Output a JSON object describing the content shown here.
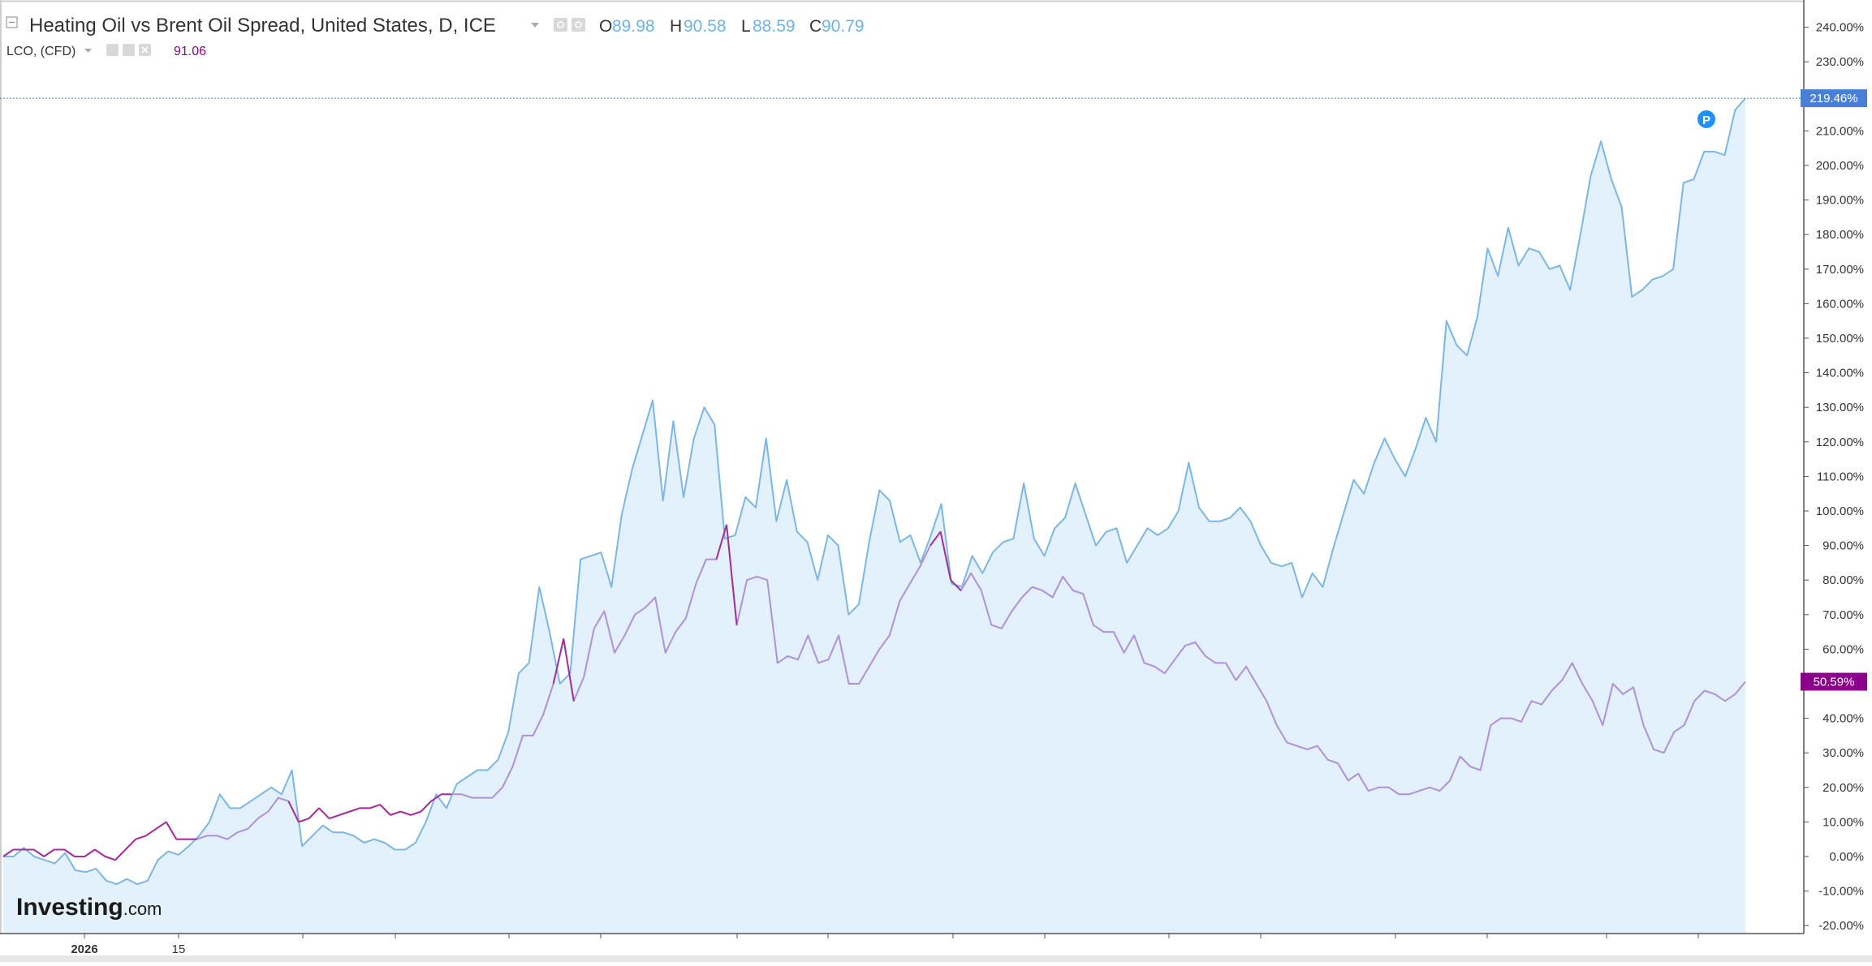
{
  "header": {
    "title": "Heating Oil vs Brent Oil Spread, United States, D, ICE",
    "ohlc": {
      "o_label": "O",
      "o_value": "89.98",
      "h_label": "H",
      "h_value": "90.58",
      "l_label": "L",
      "l_value": "88.59",
      "c_label": "C",
      "c_value": "90.79"
    },
    "compare_label": "LCO, (CFD)",
    "compare_value": "91.06"
  },
  "logo": {
    "brand": "Investing",
    "suffix": ".com"
  },
  "price_tags": {
    "main": "219.46%",
    "compare": "50.59%",
    "marker": "P"
  },
  "colors": {
    "main_line": "#7cb6e4",
    "main_fill": "#e2f1fb",
    "compare_line": "#b090d8",
    "compare_dark": "#a5309a",
    "compare_tag": "#8b008b",
    "main_tag": "#4a7fd8",
    "ohlc_value": "#6fb3e6",
    "grid": "#d8d8d8"
  },
  "chart_data": {
    "type": "line",
    "xlabel": "",
    "ylabel": "",
    "ylim": [
      -22,
      244
    ],
    "y_ticks": [
      "240.00%",
      "230.00%",
      "220.00%",
      "210.00%",
      "200.00%",
      "190.00%",
      "180.00%",
      "170.00%",
      "160.00%",
      "150.00%",
      "140.00%",
      "130.00%",
      "120.00%",
      "110.00%",
      "100.00%",
      "90.00%",
      "80.00%",
      "70.00%",
      "60.00%",
      "50.00%",
      "40.00%",
      "30.00%",
      "20.00%",
      "10.00%",
      "0.00%",
      "-10.00%",
      "-20.00%"
    ],
    "x_ticks": [
      "2026",
      "15"
    ],
    "series": [
      {
        "values": [
          0,
          0,
          2.5,
          0,
          -1,
          -2,
          1,
          -4,
          -4.5,
          -3.5,
          -7,
          -8,
          -6.5,
          -8,
          -7,
          -1,
          1.5,
          0.5,
          3,
          6,
          10,
          18,
          14,
          14,
          16,
          18,
          20,
          18,
          25,
          3,
          6,
          9,
          7,
          7,
          6,
          4,
          5,
          4,
          2,
          2,
          4,
          10,
          18,
          14,
          21,
          23,
          25,
          25,
          28,
          36,
          53,
          56,
          78,
          65,
          50,
          53,
          86,
          87,
          88,
          78,
          99,
          112,
          122,
          132,
          103,
          126,
          104,
          121,
          130,
          125,
          92,
          93,
          104,
          101,
          121,
          97,
          109,
          94,
          91,
          80,
          93,
          90,
          70,
          73,
          91,
          106,
          103,
          91,
          93,
          85,
          93,
          102,
          79,
          78,
          87,
          82,
          88,
          91,
          92,
          108,
          92,
          87,
          95,
          98,
          108,
          99,
          90,
          94,
          95,
          85,
          90,
          95,
          93,
          95,
          100,
          114,
          101,
          97,
          97,
          98,
          101,
          97,
          90,
          85,
          84,
          85,
          75,
          82,
          78,
          89,
          99,
          109,
          105,
          114,
          121,
          115,
          110,
          118,
          127,
          120,
          155,
          148,
          145,
          156,
          176,
          168,
          182,
          171,
          176,
          175,
          170,
          171,
          164,
          180,
          197,
          207,
          196,
          188,
          162,
          164,
          167,
          168,
          170,
          195,
          196,
          204,
          204,
          203,
          216,
          219.46
        ]
      },
      {
        "values": [
          0,
          2,
          2,
          2,
          0,
          2,
          2,
          0,
          0,
          2,
          0,
          -1,
          2,
          5,
          6,
          8,
          10,
          5,
          5,
          5,
          6,
          6,
          5,
          7,
          8,
          11,
          13,
          17,
          16,
          10,
          11,
          14,
          11,
          12,
          13,
          14,
          14,
          15,
          12,
          13,
          12,
          13,
          16,
          18,
          18,
          18,
          17,
          17,
          17,
          20,
          26,
          35,
          35,
          41,
          50,
          63,
          45,
          52,
          66,
          71,
          59,
          64,
          70,
          72,
          75,
          59,
          65,
          69,
          79,
          86,
          86,
          96,
          67,
          80,
          81,
          80,
          56,
          58,
          57,
          64,
          56,
          57,
          64,
          50,
          50,
          55,
          60,
          64,
          74,
          79,
          84,
          90,
          94,
          80,
          77,
          82,
          77,
          67,
          66,
          71,
          75,
          78,
          77,
          75,
          81,
          77,
          76,
          67,
          65,
          65,
          59,
          64,
          56,
          55,
          53,
          57,
          61,
          62,
          58,
          56,
          56,
          51,
          55,
          50,
          45,
          38,
          33,
          32,
          31,
          32,
          28,
          27,
          22,
          24,
          19,
          20,
          20,
          18,
          18,
          19,
          20,
          19,
          22,
          29,
          26,
          25,
          38,
          40,
          40,
          39,
          45,
          44,
          48,
          51,
          56,
          50,
          45,
          38,
          50,
          47,
          49,
          38,
          31,
          30,
          36,
          38,
          45,
          48,
          47,
          45,
          47,
          50.59
        ]
      }
    ]
  }
}
